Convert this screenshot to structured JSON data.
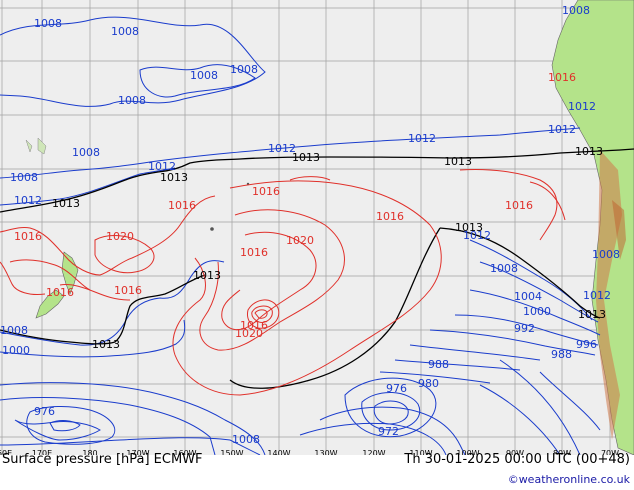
{
  "title": "Surface pressure [hPa] ECMWF",
  "date": "Th 30-01-2025 00:00 UTC (00+48)",
  "credit": "©weatheronline.co.uk",
  "longitude_ticks": [
    "160E",
    "170E",
    "180",
    "170W",
    "160W",
    "150W",
    "140W",
    "130W",
    "120W",
    "110W",
    "100W",
    "90W",
    "80W",
    "70W"
  ],
  "isobar_labels": [
    {
      "text": "1008",
      "color": "#1a3ccc"
    },
    {
      "text": "1008",
      "color": "#1a3ccc"
    },
    {
      "text": "1008",
      "color": "#1a3ccc"
    },
    {
      "text": "1008",
      "color": "#1a3ccc"
    },
    {
      "text": "1008",
      "color": "#1a3ccc"
    },
    {
      "text": "1008",
      "color": "#1a3ccc"
    },
    {
      "text": "1008",
      "color": "#1a3ccc"
    },
    {
      "text": "1012",
      "color": "#1a3ccc"
    },
    {
      "text": "1012",
      "color": "#1a3ccc"
    },
    {
      "text": "1012",
      "color": "#1a3ccc"
    },
    {
      "text": "1012",
      "color": "#1a3ccc"
    },
    {
      "text": "1012",
      "color": "#1a3ccc"
    },
    {
      "text": "1013",
      "color": "#000000"
    },
    {
      "text": "1013",
      "color": "#000000"
    },
    {
      "text": "1013",
      "color": "#000000"
    },
    {
      "text": "1013",
      "color": "#000000"
    },
    {
      "text": "1013",
      "color": "#000000"
    },
    {
      "text": "1013",
      "color": "#000000"
    },
    {
      "text": "1013",
      "color": "#000000"
    },
    {
      "text": "1013",
      "color": "#000000"
    },
    {
      "text": "1013",
      "color": "#000000"
    },
    {
      "text": "1016",
      "color": "#e0302a"
    },
    {
      "text": "1016",
      "color": "#e0302a"
    },
    {
      "text": "1016",
      "color": "#e0302a"
    },
    {
      "text": "1016",
      "color": "#e0302a"
    },
    {
      "text": "1016",
      "color": "#e0302a"
    },
    {
      "text": "1016",
      "color": "#e0302a"
    },
    {
      "text": "1016",
      "color": "#e0302a"
    },
    {
      "text": "1016",
      "color": "#e0302a"
    },
    {
      "text": "1016",
      "color": "#e0302a"
    },
    {
      "text": "1020",
      "color": "#e0302a"
    },
    {
      "text": "1020",
      "color": "#e0302a"
    },
    {
      "text": "1020",
      "color": "#e0302a"
    },
    {
      "text": "1012",
      "color": "#1a3ccc"
    },
    {
      "text": "1008",
      "color": "#1a3ccc"
    },
    {
      "text": "1004",
      "color": "#1a3ccc"
    },
    {
      "text": "1000",
      "color": "#1a3ccc"
    },
    {
      "text": "992",
      "color": "#1a3ccc"
    },
    {
      "text": "988",
      "color": "#1a3ccc"
    },
    {
      "text": "988",
      "color": "#1a3ccc"
    },
    {
      "text": "980",
      "color": "#1a3ccc"
    },
    {
      "text": "976",
      "color": "#1a3ccc"
    },
    {
      "text": "972",
      "color": "#1a3ccc"
    },
    {
      "text": "976",
      "color": "#1a3ccc"
    },
    {
      "text": "1000",
      "color": "#1a3ccc"
    },
    {
      "text": "1008",
      "color": "#1a3ccc"
    },
    {
      "text": "1008",
      "color": "#1a3ccc"
    },
    {
      "text": "1008",
      "color": "#1a3ccc"
    },
    {
      "text": "1008",
      "color": "#1a3ccc"
    },
    {
      "text": "996",
      "color": "#1a3ccc"
    },
    {
      "text": "1012",
      "color": "#1a3ccc"
    },
    {
      "text": "1012",
      "color": "#1a3ccc"
    },
    {
      "text": "1016",
      "color": "#e0302a"
    }
  ]
}
